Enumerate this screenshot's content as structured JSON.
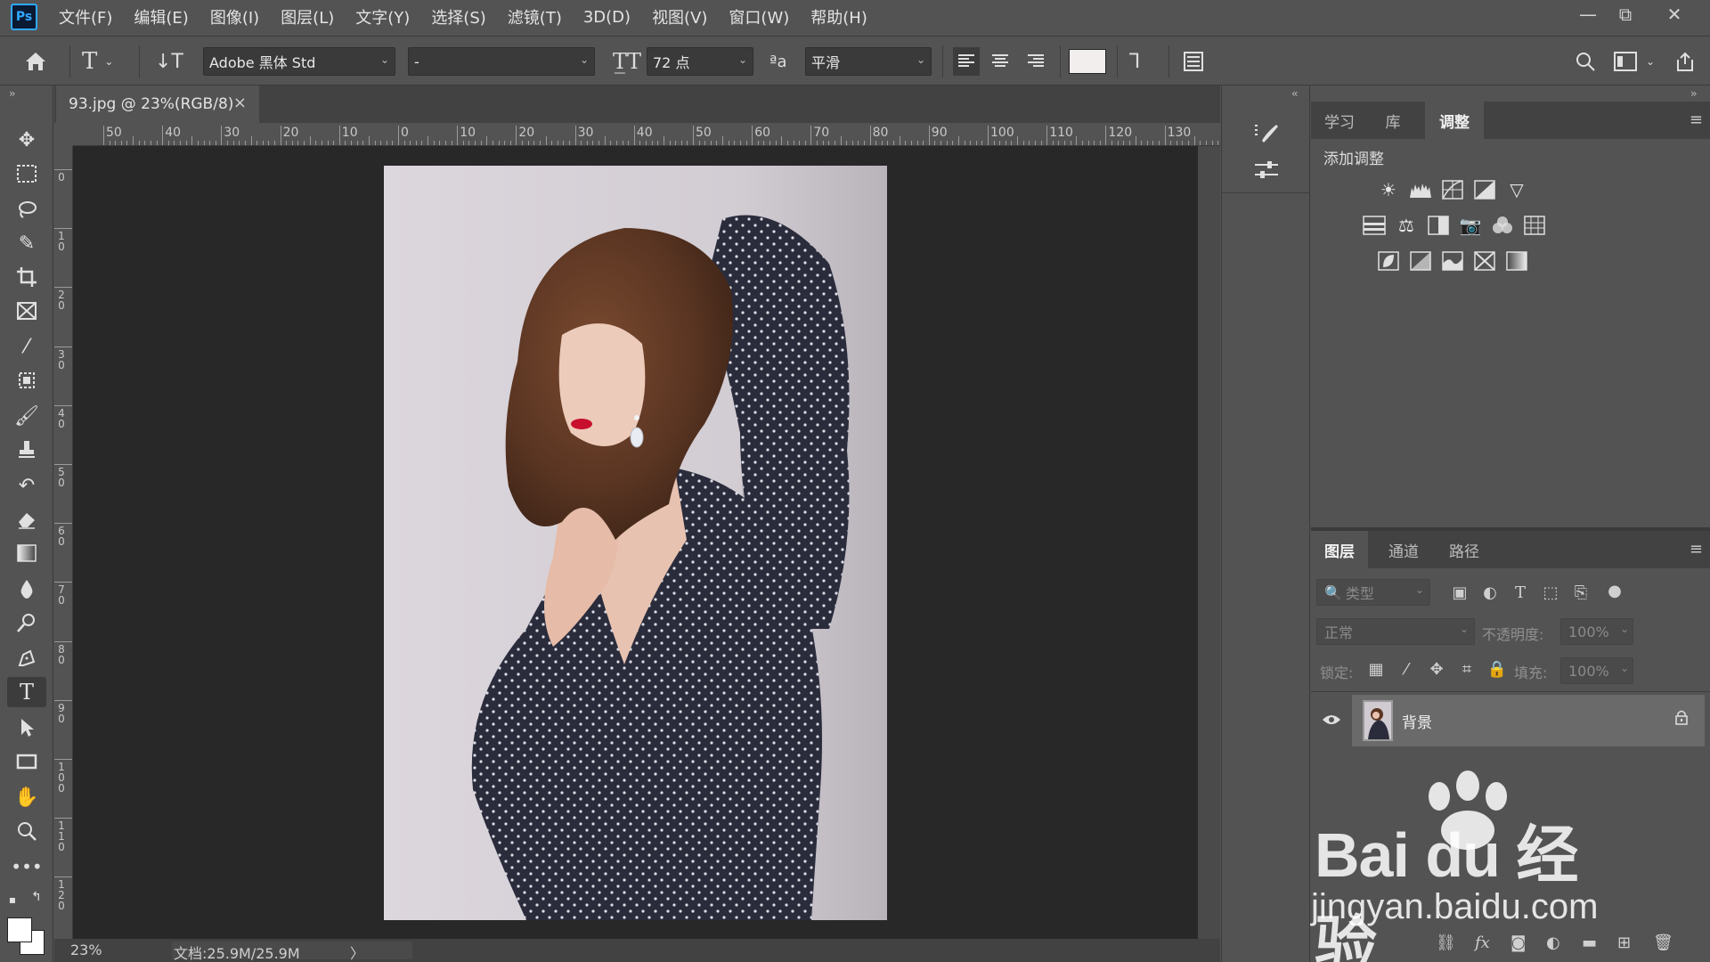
{
  "app": {
    "logo_text": "Ps"
  },
  "menu": [
    "文件(F)",
    "编辑(E)",
    "图像(I)",
    "图层(L)",
    "文字(Y)",
    "选择(S)",
    "滤镜(T)",
    "3D(D)",
    "视图(V)",
    "窗口(W)",
    "帮助(H)"
  ],
  "window_controls": {
    "minimize": "—",
    "restore": "⧉",
    "close": "✕"
  },
  "options_bar": {
    "font_family": "Adobe 黑体 Std",
    "font_style": "-",
    "font_size": "72 点",
    "antialias_label": "ªa",
    "antialias": "平滑",
    "text_color": "#f2eeee"
  },
  "document": {
    "tab_title": "93.jpg @ 23%(RGB/8)",
    "tab_close": "×",
    "zoom": "23%",
    "doc_info": "文档:25.9M/25.9M",
    "status_arrow": "〉"
  },
  "ruler": {
    "top_labels": [
      "50",
      "40",
      "30",
      "20",
      "10",
      "0",
      "10",
      "20",
      "30",
      "40",
      "50",
      "60",
      "70",
      "80",
      "90",
      "100",
      "110",
      "120",
      "130"
    ],
    "left_labels": [
      "0",
      "1 0",
      "2 0",
      "3 0",
      "4 0",
      "5 0",
      "6 0",
      "7 0",
      "8 0",
      "9 0",
      "1 0 0",
      "1 1 0",
      "1 2 0"
    ]
  },
  "adjustments_panel": {
    "tabs": [
      "学习",
      "库",
      "调整"
    ],
    "active_tab": "调整",
    "title": "添加调整"
  },
  "layers_panel": {
    "tabs": [
      "图层",
      "通道",
      "路径"
    ],
    "active_tab": "图层",
    "filter_placeholder": "类型",
    "blend_mode": "正常",
    "opacity_label": "不透明度:",
    "opacity_value": "100%",
    "lock_label": "锁定:",
    "fill_label": "填充:",
    "fill_value": "100%",
    "layers": [
      {
        "name": "背景",
        "visible": true,
        "locked": true
      }
    ]
  },
  "watermark": {
    "main": "Bai du 经验",
    "sub": "jingyan.baidu.com"
  }
}
